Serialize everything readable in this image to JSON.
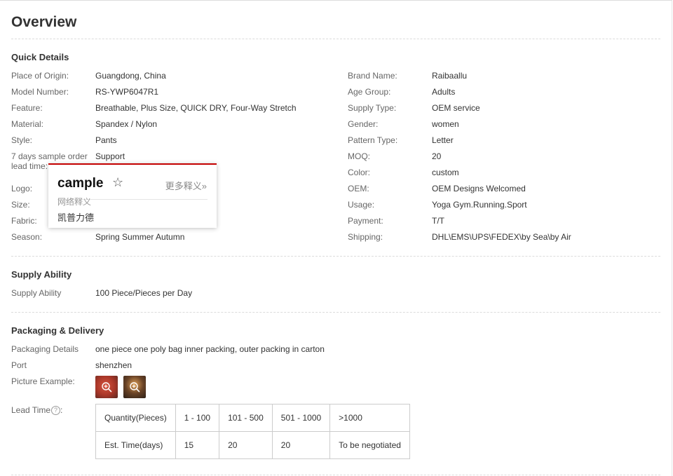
{
  "overview": {
    "title": "Overview"
  },
  "quick_details": {
    "heading": "Quick Details",
    "left": [
      {
        "label": "Place of Origin:",
        "value": "Guangdong, China"
      },
      {
        "label": "Model Number:",
        "value": "RS-YWP6047R1"
      },
      {
        "label": "Feature:",
        "value": "Breathable, Plus Size, QUICK DRY, Four-Way Stretch"
      },
      {
        "label": "Material:",
        "value": "Spandex / Nylon"
      },
      {
        "label": "Style:",
        "value": "Pants"
      },
      {
        "label": "7 days sample order lead time:",
        "value": "Support"
      },
      {
        "label": "Logo:",
        "value": ""
      },
      {
        "label": "Size:",
        "value": ""
      },
      {
        "label": "Fabric:",
        "value": ""
      },
      {
        "label": "Season:",
        "value": "Spring Summer Autumn"
      }
    ],
    "right": [
      {
        "label": "Brand Name:",
        "value": "Raibaallu"
      },
      {
        "label": "Age Group:",
        "value": "Adults"
      },
      {
        "label": "Supply Type:",
        "value": "OEM service"
      },
      {
        "label": "Gender:",
        "value": "women"
      },
      {
        "label": "Pattern Type:",
        "value": "Letter"
      },
      {
        "label": "MOQ:",
        "value": "20"
      },
      {
        "label": "Color:",
        "value": "custom"
      },
      {
        "label": "OEM:",
        "value": "OEM Designs Welcomed"
      },
      {
        "label": "Usage:",
        "value": "Yoga Gym.Running.Sport"
      },
      {
        "label": "Payment:",
        "value": "T/T"
      },
      {
        "label": "Shipping:",
        "value": "DHL\\EMS\\UPS\\FEDEX\\by Sea\\by Air"
      }
    ]
  },
  "supply_ability": {
    "heading": "Supply Ability",
    "label": "Supply Ability",
    "value": "100 Piece/Pieces per Day"
  },
  "packaging": {
    "heading": "Packaging & Delivery",
    "details_label": "Packaging Details",
    "details_value": "one piece one poly bag inner packing, outer packing in carton",
    "port_label": "Port",
    "port_value": "shenzhen",
    "picture_label": "Picture Example:",
    "lead_time_label": "Lead Time",
    "lead_time_suffix": ":",
    "help_icon": "question-circle-icon",
    "lead_table": {
      "header": [
        "Quantity(Pieces)",
        "1 - 100",
        "101 - 500",
        "501 - 1000",
        ">1000"
      ],
      "row": [
        "Est. Time(days)",
        "15",
        "20",
        "20",
        "To be negotiated"
      ]
    }
  },
  "dictionary_popup": {
    "word": "cample",
    "star_icon": "star-outline-icon",
    "more_link": "更多释义»",
    "section": "网络释义",
    "translation": "凯普力德",
    "accent_color": "#c40000"
  }
}
